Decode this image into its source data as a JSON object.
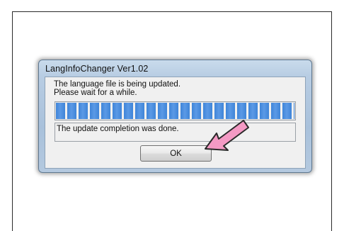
{
  "dialog": {
    "title": "LangInfoChanger Ver1.02",
    "message": "The language file is being updated.\nPlease wait for a while.",
    "progress": {
      "fraction": 1.0
    },
    "status_text": "The update completion was done.",
    "ok_label": "OK"
  },
  "annotation": {
    "arrow_icon": "pointer-arrow-icon",
    "arrow_color": "#f49ac4"
  },
  "colors": {
    "progress_fill": "#3f84d8",
    "title_bar": "#b8cde3"
  }
}
